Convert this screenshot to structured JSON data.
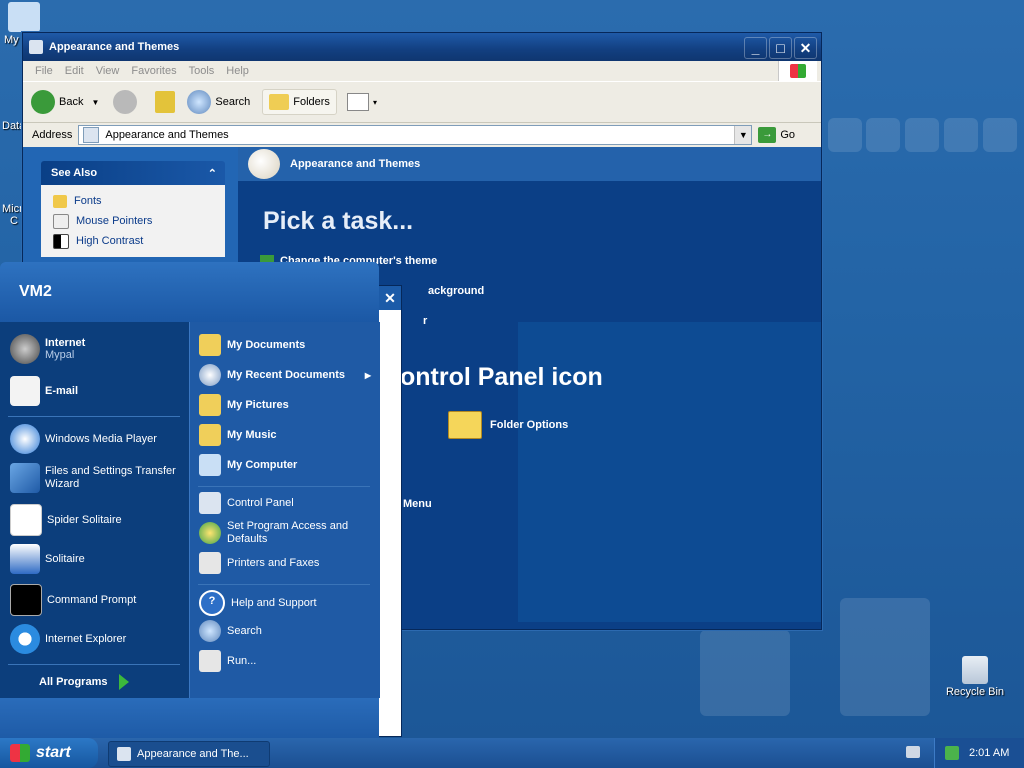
{
  "desktop": {
    "icons": [
      {
        "label": "My"
      },
      {
        "label": "Data"
      },
      {
        "label": "Micro C"
      },
      {
        "label": "Recycle Bin"
      }
    ]
  },
  "window": {
    "title": "Appearance and Themes",
    "menu": [
      "File",
      "Edit",
      "View",
      "Favorites",
      "Tools",
      "Help"
    ],
    "toolbar": {
      "back": "Back",
      "search": "Search",
      "folders": "Folders"
    },
    "address_label": "Address",
    "address_value": "Appearance and Themes",
    "go": "Go",
    "see_also": {
      "title": "See Also",
      "items": [
        "Fonts",
        "Mouse Pointers",
        "High Contrast"
      ]
    },
    "header": "Appearance and Themes",
    "pick_task": "Pick a task...",
    "tasks": [
      "Change the computer's theme",
      "ackground",
      "r"
    ],
    "cp_title": "ontrol Panel icon",
    "folder_options": "Folder Options",
    "menu_text": "Menu"
  },
  "start_menu": {
    "user": "VM2",
    "pinned": [
      {
        "label": "Internet",
        "sub": "Mypal"
      },
      {
        "label": "E-mail"
      }
    ],
    "recent": [
      "Windows Media Player",
      "Files and Settings Transfer Wizard",
      "Spider Solitaire",
      "Solitaire",
      "Command Prompt",
      "Internet Explorer"
    ],
    "all_programs": "All Programs",
    "right": {
      "places": [
        "My Documents",
        "My Recent Documents",
        "My Pictures",
        "My Music",
        "My Computer"
      ],
      "settings": [
        "Control Panel",
        "Set Program Access and Defaults",
        "Printers and Faxes"
      ],
      "help": [
        "Help and Support",
        "Search",
        "Run..."
      ]
    }
  },
  "taskbar": {
    "start": "start",
    "task": "Appearance and The...",
    "clock": "2:01 AM"
  }
}
